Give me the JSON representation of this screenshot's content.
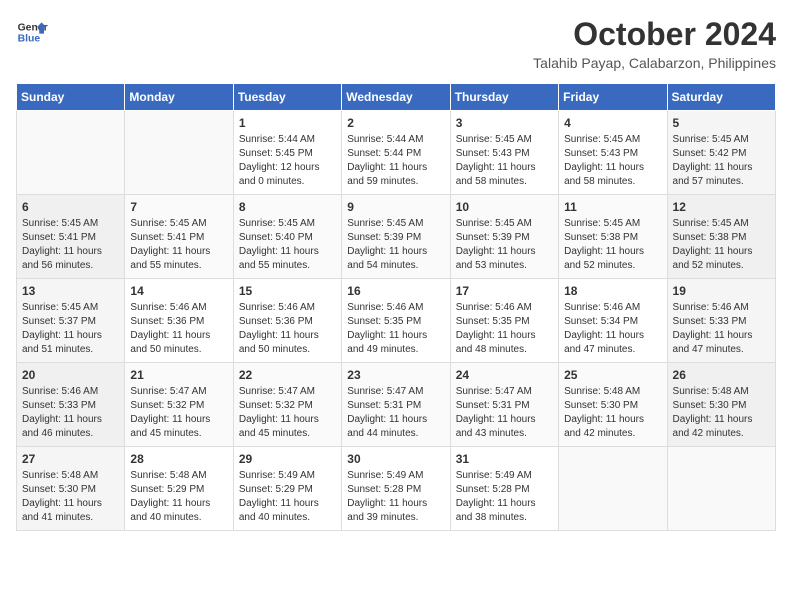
{
  "header": {
    "logo_line1": "General",
    "logo_line2": "Blue",
    "month": "October 2024",
    "location": "Talahib Payap, Calabarzon, Philippines"
  },
  "weekdays": [
    "Sunday",
    "Monday",
    "Tuesday",
    "Wednesday",
    "Thursday",
    "Friday",
    "Saturday"
  ],
  "weeks": [
    [
      {
        "day": "",
        "sunrise": "",
        "sunset": "",
        "daylight": ""
      },
      {
        "day": "",
        "sunrise": "",
        "sunset": "",
        "daylight": ""
      },
      {
        "day": "1",
        "sunrise": "Sunrise: 5:44 AM",
        "sunset": "Sunset: 5:45 PM",
        "daylight": "Daylight: 12 hours and 0 minutes."
      },
      {
        "day": "2",
        "sunrise": "Sunrise: 5:44 AM",
        "sunset": "Sunset: 5:44 PM",
        "daylight": "Daylight: 11 hours and 59 minutes."
      },
      {
        "day": "3",
        "sunrise": "Sunrise: 5:45 AM",
        "sunset": "Sunset: 5:43 PM",
        "daylight": "Daylight: 11 hours and 58 minutes."
      },
      {
        "day": "4",
        "sunrise": "Sunrise: 5:45 AM",
        "sunset": "Sunset: 5:43 PM",
        "daylight": "Daylight: 11 hours and 58 minutes."
      },
      {
        "day": "5",
        "sunrise": "Sunrise: 5:45 AM",
        "sunset": "Sunset: 5:42 PM",
        "daylight": "Daylight: 11 hours and 57 minutes."
      }
    ],
    [
      {
        "day": "6",
        "sunrise": "Sunrise: 5:45 AM",
        "sunset": "Sunset: 5:41 PM",
        "daylight": "Daylight: 11 hours and 56 minutes."
      },
      {
        "day": "7",
        "sunrise": "Sunrise: 5:45 AM",
        "sunset": "Sunset: 5:41 PM",
        "daylight": "Daylight: 11 hours and 55 minutes."
      },
      {
        "day": "8",
        "sunrise": "Sunrise: 5:45 AM",
        "sunset": "Sunset: 5:40 PM",
        "daylight": "Daylight: 11 hours and 55 minutes."
      },
      {
        "day": "9",
        "sunrise": "Sunrise: 5:45 AM",
        "sunset": "Sunset: 5:39 PM",
        "daylight": "Daylight: 11 hours and 54 minutes."
      },
      {
        "day": "10",
        "sunrise": "Sunrise: 5:45 AM",
        "sunset": "Sunset: 5:39 PM",
        "daylight": "Daylight: 11 hours and 53 minutes."
      },
      {
        "day": "11",
        "sunrise": "Sunrise: 5:45 AM",
        "sunset": "Sunset: 5:38 PM",
        "daylight": "Daylight: 11 hours and 52 minutes."
      },
      {
        "day": "12",
        "sunrise": "Sunrise: 5:45 AM",
        "sunset": "Sunset: 5:38 PM",
        "daylight": "Daylight: 11 hours and 52 minutes."
      }
    ],
    [
      {
        "day": "13",
        "sunrise": "Sunrise: 5:45 AM",
        "sunset": "Sunset: 5:37 PM",
        "daylight": "Daylight: 11 hours and 51 minutes."
      },
      {
        "day": "14",
        "sunrise": "Sunrise: 5:46 AM",
        "sunset": "Sunset: 5:36 PM",
        "daylight": "Daylight: 11 hours and 50 minutes."
      },
      {
        "day": "15",
        "sunrise": "Sunrise: 5:46 AM",
        "sunset": "Sunset: 5:36 PM",
        "daylight": "Daylight: 11 hours and 50 minutes."
      },
      {
        "day": "16",
        "sunrise": "Sunrise: 5:46 AM",
        "sunset": "Sunset: 5:35 PM",
        "daylight": "Daylight: 11 hours and 49 minutes."
      },
      {
        "day": "17",
        "sunrise": "Sunrise: 5:46 AM",
        "sunset": "Sunset: 5:35 PM",
        "daylight": "Daylight: 11 hours and 48 minutes."
      },
      {
        "day": "18",
        "sunrise": "Sunrise: 5:46 AM",
        "sunset": "Sunset: 5:34 PM",
        "daylight": "Daylight: 11 hours and 47 minutes."
      },
      {
        "day": "19",
        "sunrise": "Sunrise: 5:46 AM",
        "sunset": "Sunset: 5:33 PM",
        "daylight": "Daylight: 11 hours and 47 minutes."
      }
    ],
    [
      {
        "day": "20",
        "sunrise": "Sunrise: 5:46 AM",
        "sunset": "Sunset: 5:33 PM",
        "daylight": "Daylight: 11 hours and 46 minutes."
      },
      {
        "day": "21",
        "sunrise": "Sunrise: 5:47 AM",
        "sunset": "Sunset: 5:32 PM",
        "daylight": "Daylight: 11 hours and 45 minutes."
      },
      {
        "day": "22",
        "sunrise": "Sunrise: 5:47 AM",
        "sunset": "Sunset: 5:32 PM",
        "daylight": "Daylight: 11 hours and 45 minutes."
      },
      {
        "day": "23",
        "sunrise": "Sunrise: 5:47 AM",
        "sunset": "Sunset: 5:31 PM",
        "daylight": "Daylight: 11 hours and 44 minutes."
      },
      {
        "day": "24",
        "sunrise": "Sunrise: 5:47 AM",
        "sunset": "Sunset: 5:31 PM",
        "daylight": "Daylight: 11 hours and 43 minutes."
      },
      {
        "day": "25",
        "sunrise": "Sunrise: 5:48 AM",
        "sunset": "Sunset: 5:30 PM",
        "daylight": "Daylight: 11 hours and 42 minutes."
      },
      {
        "day": "26",
        "sunrise": "Sunrise: 5:48 AM",
        "sunset": "Sunset: 5:30 PM",
        "daylight": "Daylight: 11 hours and 42 minutes."
      }
    ],
    [
      {
        "day": "27",
        "sunrise": "Sunrise: 5:48 AM",
        "sunset": "Sunset: 5:30 PM",
        "daylight": "Daylight: 11 hours and 41 minutes."
      },
      {
        "day": "28",
        "sunrise": "Sunrise: 5:48 AM",
        "sunset": "Sunset: 5:29 PM",
        "daylight": "Daylight: 11 hours and 40 minutes."
      },
      {
        "day": "29",
        "sunrise": "Sunrise: 5:49 AM",
        "sunset": "Sunset: 5:29 PM",
        "daylight": "Daylight: 11 hours and 40 minutes."
      },
      {
        "day": "30",
        "sunrise": "Sunrise: 5:49 AM",
        "sunset": "Sunset: 5:28 PM",
        "daylight": "Daylight: 11 hours and 39 minutes."
      },
      {
        "day": "31",
        "sunrise": "Sunrise: 5:49 AM",
        "sunset": "Sunset: 5:28 PM",
        "daylight": "Daylight: 11 hours and 38 minutes."
      },
      {
        "day": "",
        "sunrise": "",
        "sunset": "",
        "daylight": ""
      },
      {
        "day": "",
        "sunrise": "",
        "sunset": "",
        "daylight": ""
      }
    ]
  ]
}
